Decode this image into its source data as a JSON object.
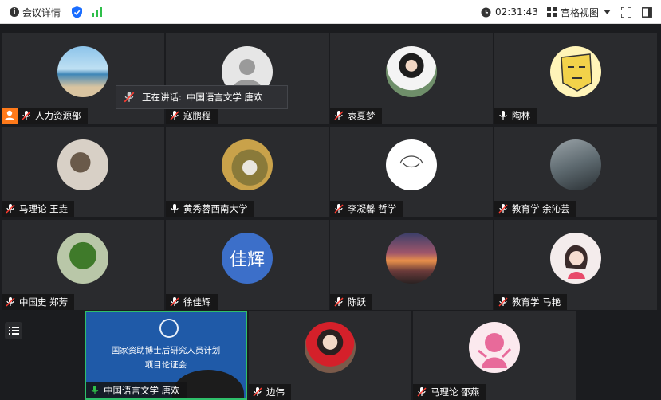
{
  "topbar": {
    "meeting_info": "会议详情",
    "timer": "02:31:43",
    "view_mode": "宫格视图",
    "colors": {
      "shield": "#1a6dff",
      "signal": "#2fbf4a"
    }
  },
  "speaking": {
    "label": "正在讲话:",
    "name": "中国语言文学 唐欢"
  },
  "participants": [
    {
      "name": "人力资源部"
    },
    {
      "name": "寇鹏程"
    },
    {
      "name": "袁夏梦"
    },
    {
      "name": "陶林"
    },
    {
      "name": "马理论 王垚"
    },
    {
      "name": "黄秀蓉西南大学"
    },
    {
      "name": "李凝馨 哲学"
    },
    {
      "name": "教育学 余沁芸"
    },
    {
      "name": "中国史 郑芳"
    },
    {
      "name": "徐佳辉",
      "avatar_text": "佳辉"
    },
    {
      "name": "陈跃"
    },
    {
      "name": "教育学 马艳"
    }
  ],
  "bottom_participants": [
    {
      "name": "中国语言文学 唐欢"
    },
    {
      "name": "边伟"
    },
    {
      "name": "马理论 邵燕"
    }
  ],
  "shared_slide": {
    "title_line1": "国家资助博士后研究人员计划",
    "title_line2": "项目论证会"
  }
}
